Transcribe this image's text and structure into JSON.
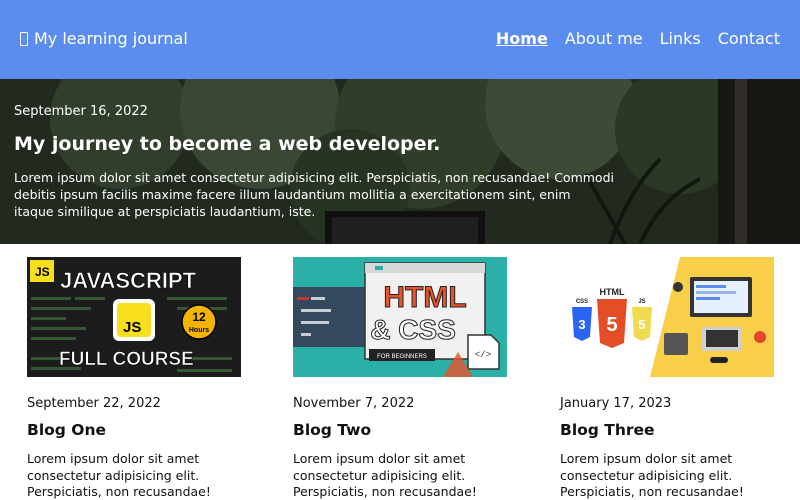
{
  "header": {
    "brand": "My learning journal",
    "nav": [
      "Home",
      "About me",
      "Links",
      "Contact"
    ],
    "active_nav": "Home",
    "background_color": "#5b8def"
  },
  "hero": {
    "date": "September 16, 2022",
    "title": "My journey to become a web developer.",
    "text": "Lorem ipsum dolor sit amet consectetur adipisicing elit. Perspiciatis, non recusandae! Commodi debitis ipsum facilis maxime facere illum laudantium mollitia a exercitationem sint, enim itaque similique at perspiciatis laudantium, iste."
  },
  "posts": [
    {
      "date": "September 22, 2022",
      "title": "Blog One",
      "excerpt": "Lorem ipsum dolor sit amet consectetur adipisicing elit. Perspiciatis, non recusandae!",
      "thumb": {
        "badge": "JS",
        "line1": "JAVASCRIPT",
        "line2": "FULL COURSE",
        "hours_num": "12",
        "hours_label": "Hours"
      }
    },
    {
      "date": "November 7, 2022",
      "title": "Blog Two",
      "excerpt": "Lorem ipsum dolor sit amet consectetur adipisicing elit. Perspiciatis, non recusandae!",
      "thumb": {
        "line1": "HTML",
        "line2": "& CSS",
        "sub": "FOR BEGINNERS",
        "code_symbol": "</>"
      }
    },
    {
      "date": "January 17, 2023",
      "title": "Blog Three",
      "excerpt": "Lorem ipsum dolor sit amet consectetur adipisicing elit. Perspiciatis, non recusandae!",
      "thumb": {
        "label_html": "HTML",
        "label_css": "CSS",
        "label_js": "JS",
        "num_css": "3",
        "num_html": "5",
        "num_js": "5"
      }
    }
  ]
}
